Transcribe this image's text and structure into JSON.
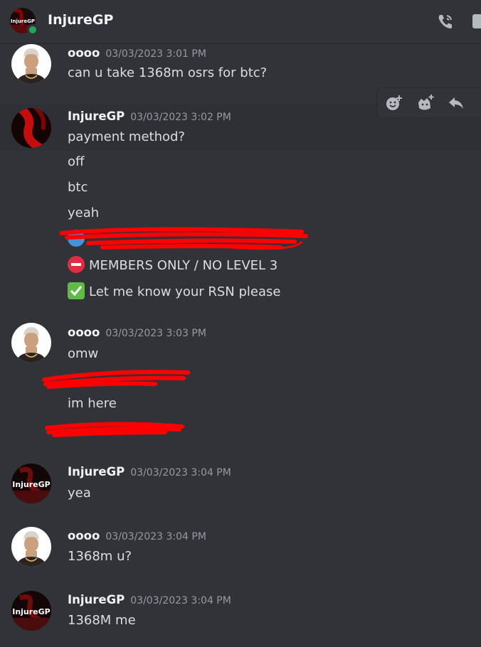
{
  "header": {
    "title": "InjureGP",
    "avatar_text": "InjureGP",
    "status": "online",
    "icons": [
      "call-icon",
      "video-icon"
    ]
  },
  "toolbar": {
    "icons": [
      "add-reaction-icon",
      "super-reaction-icon",
      "reply-icon"
    ]
  },
  "messages": [
    {
      "author": "oooo",
      "timestamp": "03/03/2023 3:01 PM",
      "lines": [
        "can u take 1368m osrs for btc?"
      ]
    },
    {
      "author": "InjureGP",
      "timestamp": "03/03/2023 3:02 PM",
      "lines": [
        "payment method?",
        "off",
        "btc",
        "yeah",
        "MEMBERS ONLY / NO LEVEL 3",
        "Let me know your RSN please"
      ]
    },
    {
      "author": "oooo",
      "timestamp": "03/03/2023 3:03 PM",
      "lines": [
        "omw",
        "im here"
      ]
    },
    {
      "author": "InjureGP",
      "timestamp": "03/03/2023 3:04 PM",
      "lines": [
        "yea"
      ],
      "avatar_text": "InjureGP"
    },
    {
      "author": "oooo",
      "timestamp": "03/03/2023 3:04 PM",
      "lines": [
        "1368m u?"
      ]
    },
    {
      "author": "InjureGP",
      "timestamp": "03/03/2023 3:04 PM",
      "lines": [
        "1368M me"
      ],
      "avatar_text": "InjureGP"
    }
  ],
  "colors": {
    "background": "#313338",
    "online": "#23a55a",
    "redaction": "#ff0000",
    "timestamp": "#949ba4"
  }
}
